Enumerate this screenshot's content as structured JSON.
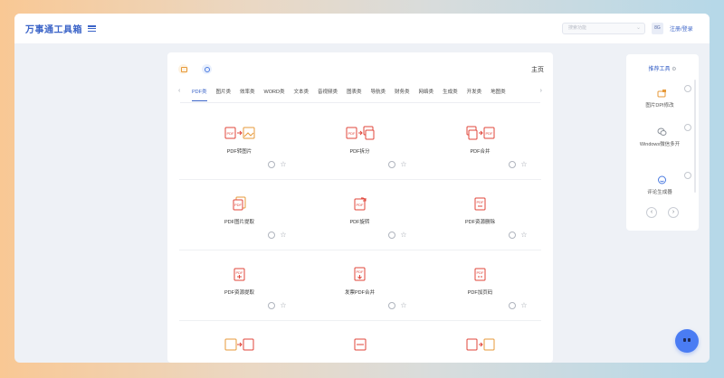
{
  "header": {
    "brand": "万事通工具箱",
    "search_placeholder": "搜索功能",
    "avatar": "8G",
    "login": "注册/登录"
  },
  "main": {
    "home_title": "主页",
    "tabs": [
      "PDF类",
      "图片类",
      "效率类",
      "WORD类",
      "文本类",
      "音视频类",
      "图表类",
      "导航类",
      "财务类",
      "网络类",
      "生成类",
      "开发类",
      "地图类"
    ],
    "active_tab": "PDF类",
    "tools": [
      {
        "name": "PDF转图片",
        "icon": "pdf-to-image-icon"
      },
      {
        "name": "PDF拆分",
        "icon": "pdf-split-icon"
      },
      {
        "name": "PDF合并",
        "icon": "pdf-merge-icon"
      },
      {
        "name": "PDF图片提取",
        "icon": "pdf-image-extract-icon"
      },
      {
        "name": "PDF旋转",
        "icon": "pdf-rotate-icon"
      },
      {
        "name": "PDF资源删除",
        "icon": "pdf-resource-delete-icon"
      },
      {
        "name": "PDF资源提取",
        "icon": "pdf-resource-extract-icon"
      },
      {
        "name": "发票PDF合并",
        "icon": "invoice-pdf-merge-icon"
      },
      {
        "name": "PDF加页码",
        "icon": "pdf-page-number-icon"
      }
    ]
  },
  "side": {
    "title": "推荐工具",
    "items": [
      {
        "label": "图片DPI修改",
        "icon": "image-dpi-icon"
      },
      {
        "label": "Windows微信多开",
        "icon": "wechat-multi-icon"
      },
      {
        "label": "评论生成器",
        "icon": "comment-generator-icon"
      }
    ],
    "prev": "‹",
    "next": "›"
  },
  "colors": {
    "accent": "#3b64c8",
    "pdf_red": "#e0453a",
    "image_orange": "#e79a3a",
    "fab": "#4a7cf3"
  }
}
